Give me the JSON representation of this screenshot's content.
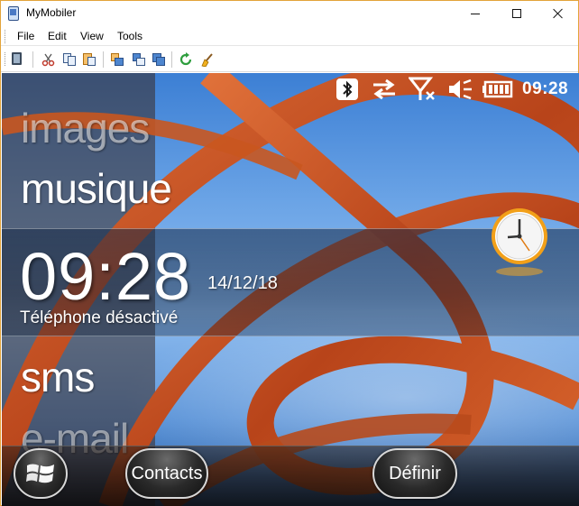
{
  "window": {
    "title": "MyMobiler",
    "menu": [
      "File",
      "Edit",
      "View",
      "Tools"
    ]
  },
  "toolbar": {
    "icons": [
      "device-icon",
      "cut-icon",
      "copy-icon",
      "paste-icon",
      "window-tile-icon",
      "window-cascade-icon",
      "window-stack-icon",
      "refresh-icon",
      "broom-icon"
    ]
  },
  "device": {
    "statusbar": {
      "time": "09:28",
      "icons": [
        "bluetooth-icon",
        "data-transfer-icon",
        "no-signal-icon",
        "speaker-muted-icon",
        "battery-icon"
      ]
    },
    "today_items": {
      "images": "images",
      "musique": "musique",
      "sms": "sms",
      "email": "e-mail"
    },
    "clock": {
      "time": "09:28",
      "date": "14/12/18",
      "phone_status": "Téléphone désactivé"
    },
    "softkeys": {
      "left": "Contacts",
      "right": "Définir"
    },
    "colors": {
      "sky": "#6ba4e6",
      "ribbon": "#c4521e",
      "window_border": "#e3a33a"
    }
  }
}
